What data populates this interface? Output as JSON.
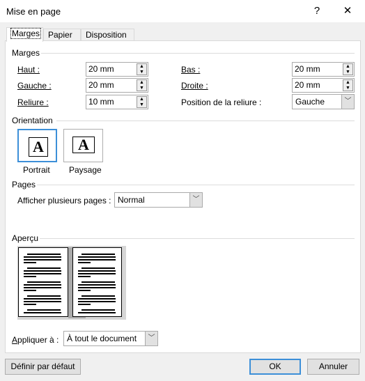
{
  "window": {
    "title": "Mise en page",
    "help": "?",
    "close": "✕"
  },
  "tabs": [
    {
      "label": "Marges",
      "active": true
    },
    {
      "label": "Papier"
    },
    {
      "label": "Disposition"
    }
  ],
  "margins": {
    "section": "Marges",
    "top": {
      "label": "Haut :",
      "value": "20 mm"
    },
    "bottom": {
      "label": "Bas :",
      "value": "20 mm"
    },
    "left": {
      "label": "Gauche :",
      "value": "20 mm"
    },
    "right": {
      "label": "Droite :",
      "value": "20 mm"
    },
    "gutter": {
      "label": "Reliure :",
      "value": "10 mm"
    },
    "gutter_pos": {
      "label": "Position de la reliure :",
      "value": "Gauche"
    }
  },
  "orientation": {
    "section": "Orientation",
    "portrait": "Portrait",
    "landscape": "Paysage",
    "selected": "Portrait",
    "glyph": "A"
  },
  "pages": {
    "section": "Pages",
    "label": "Afficher plusieurs pages :",
    "value": "Normal"
  },
  "preview": {
    "section": "Aperçu"
  },
  "apply": {
    "label": "Appliquer à :",
    "value": "À tout le document"
  },
  "buttons": {
    "default": "Définir par défaut",
    "ok": "OK",
    "cancel": "Annuler"
  },
  "colors": {
    "accent": "#3c8fd8"
  }
}
